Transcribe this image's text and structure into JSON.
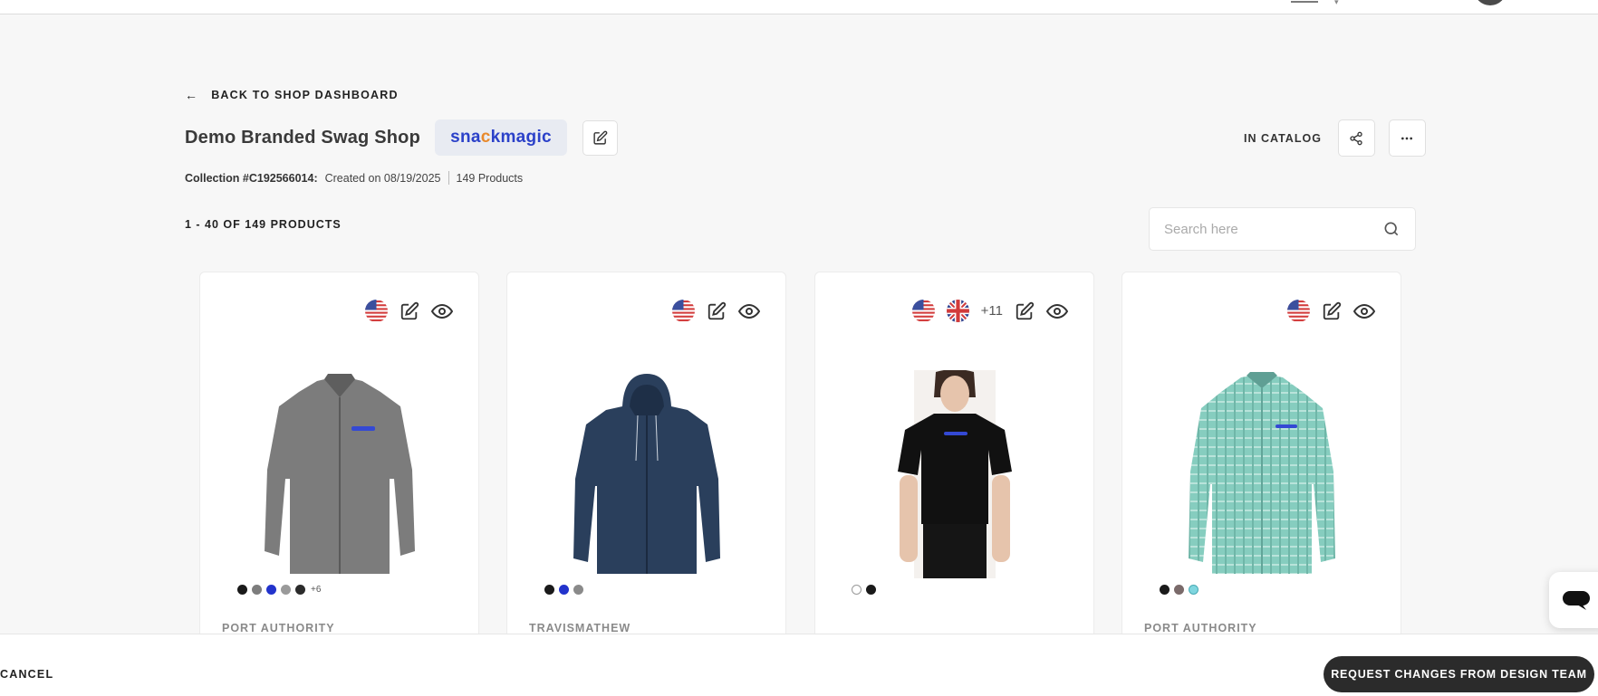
{
  "back_link": {
    "label": "BACK TO SHOP DASHBOARD"
  },
  "shop": {
    "title": "Demo Branded Swag Shop",
    "brand_logo_text": "snackmagic",
    "collection_id": "Collection #C192566014:",
    "created": "Created on 08/19/2025",
    "products_count": "149 Products",
    "status": "IN CATALOG"
  },
  "listing": {
    "range_label": "1 - 40 OF 149 PRODUCTS"
  },
  "search": {
    "placeholder": "Search here",
    "value": ""
  },
  "products": [
    {
      "brand": "PORT AUTHORITY",
      "flags": [
        "us-flag-icon"
      ],
      "extra_regions": "",
      "swatches": [
        "#1a1a1a",
        "#7d7d7d",
        "#2233cc",
        "#9a9a9a",
        "#2b2b2b"
      ],
      "more_swatches": "+6",
      "garment": "softshell jacket",
      "color": "#7c7c7c"
    },
    {
      "brand": "TRAVISMATHEW",
      "flags": [
        "us-flag-icon"
      ],
      "extra_regions": "",
      "swatches": [
        "#1a1a1a",
        "#2233cc",
        "#8a8a8a"
      ],
      "more_swatches": "",
      "garment": "hooded jacket",
      "color": "#2a3f5c"
    },
    {
      "brand": "",
      "flags": [
        "us-flag-icon",
        "uk-flag-icon"
      ],
      "extra_regions": "+11",
      "swatches": [
        "#ffffff",
        "#1a1a1a"
      ],
      "more_swatches": "",
      "garment": "t-shirt",
      "color": "#111111"
    },
    {
      "brand": "PORT AUTHORITY",
      "flags": [
        "us-flag-icon"
      ],
      "extra_regions": "",
      "swatches": [
        "#1a1a1a",
        "#7a6a6a",
        "#7fd6df"
      ],
      "more_swatches": "",
      "garment": "button-down shirt",
      "color": "#7fc9bd"
    }
  ],
  "footer": {
    "cancel_label": "CANCEL",
    "request_label": "REQUEST CHANGES FROM DESIGN TEAM"
  },
  "colors": {
    "accent": "#2b41c9",
    "dark_button": "#2b2b2b",
    "logo_accent": "#e8892b"
  }
}
